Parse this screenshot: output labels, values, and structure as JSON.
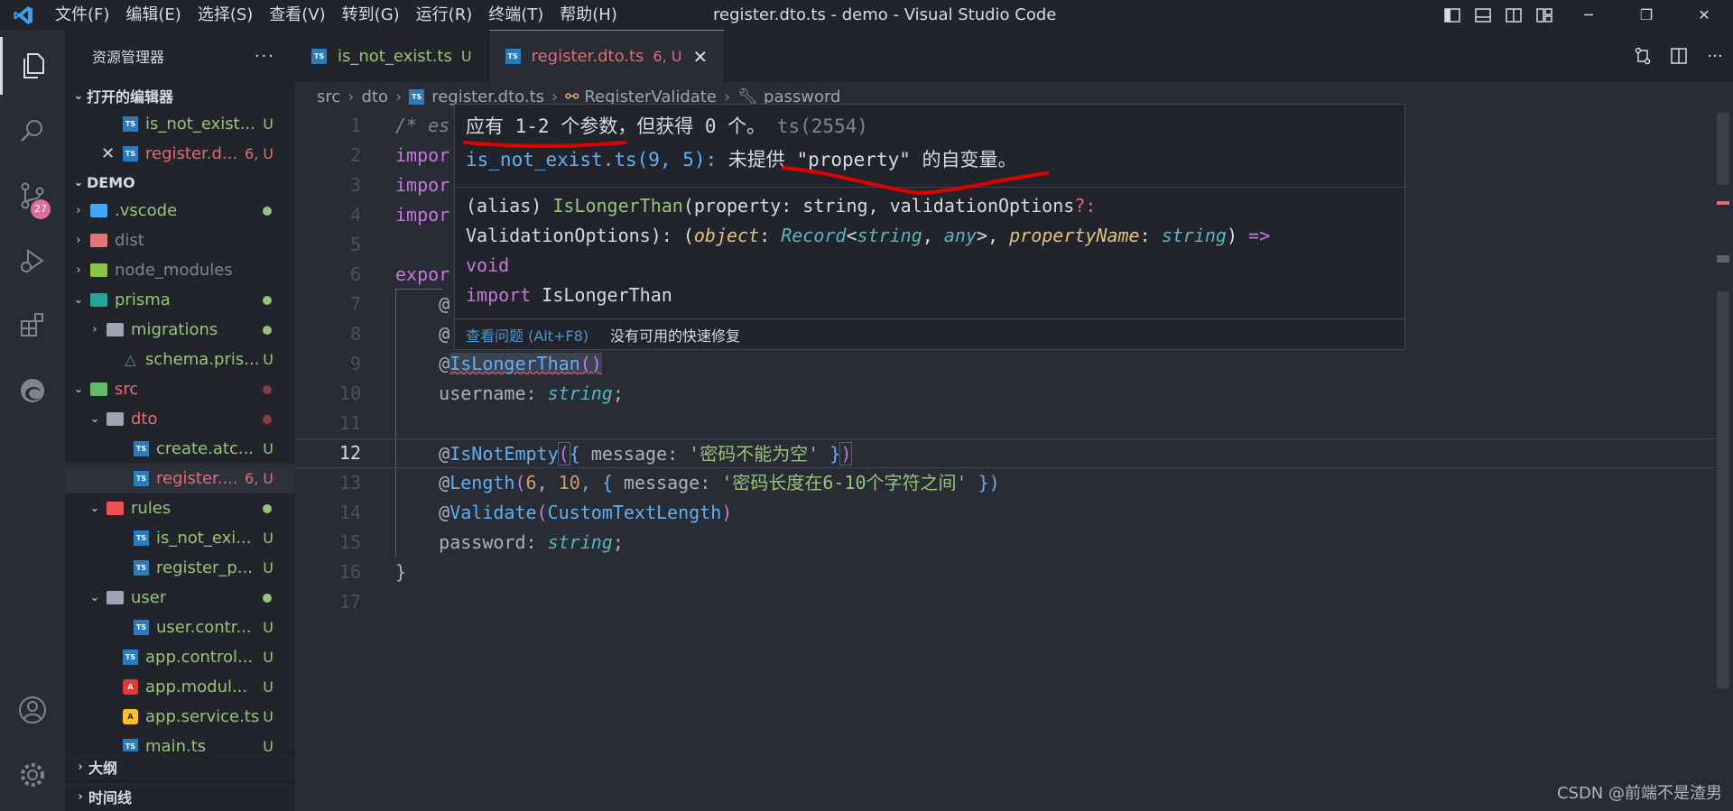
{
  "titlebar": {
    "menu": [
      "文件(F)",
      "编辑(E)",
      "选择(S)",
      "查看(V)",
      "转到(G)",
      "运行(R)",
      "终端(T)",
      "帮助(H)"
    ],
    "title": "register.dto.ts - demo - Visual Studio Code"
  },
  "activitybar": {
    "scm_badge": "27",
    "items": [
      "explorer-icon",
      "search-icon",
      "source-control-icon",
      "run-debug-icon",
      "extensions-icon",
      "edge-icon",
      "account-icon",
      "settings-gear-icon"
    ]
  },
  "sidebar": {
    "title": "资源管理器",
    "more": "···",
    "open_editors": {
      "label": "打开的编辑器",
      "items": [
        {
          "name": "is_not_exist...",
          "status": "U"
        },
        {
          "name": "register.d...",
          "status": "6, U"
        }
      ]
    },
    "workspace": {
      "label": "DEMO",
      "rows": [
        {
          "name": ".vscode",
          "kind": "folder"
        },
        {
          "name": "dist",
          "kind": "folder"
        },
        {
          "name": "node_modules",
          "kind": "folder"
        },
        {
          "name": "prisma",
          "kind": "folder"
        },
        {
          "name": "migrations",
          "kind": "folder"
        },
        {
          "name": "schema.pris...",
          "status": "U"
        },
        {
          "name": "src",
          "kind": "folder"
        },
        {
          "name": "dto",
          "kind": "folder"
        },
        {
          "name": "create.atc...",
          "status": "U"
        },
        {
          "name": "register....",
          "status": "6, U"
        },
        {
          "name": "rules",
          "kind": "folder"
        },
        {
          "name": "is_not_exi...",
          "status": "U"
        },
        {
          "name": "register_p...",
          "status": "U"
        },
        {
          "name": "user",
          "kind": "folder"
        },
        {
          "name": "user.contr...",
          "status": "U"
        },
        {
          "name": "app.control...",
          "status": "U"
        },
        {
          "name": "app.modul...",
          "status": "U"
        },
        {
          "name": "app.service.ts",
          "status": "U"
        },
        {
          "name": "main.ts",
          "status": "U"
        }
      ]
    },
    "outline_label": "大纲",
    "timeline_label": "时间线"
  },
  "tabs": [
    {
      "label": "is_not_exist.ts",
      "status": "U"
    },
    {
      "label": "register.dto.ts",
      "status": "6, U",
      "close": "✕"
    }
  ],
  "breadcrumb": [
    "src",
    "dto",
    "register.dto.ts",
    "RegisterValidate",
    "password"
  ],
  "editor": {
    "line_numbers": [
      "1",
      "2",
      "3",
      "4",
      "5",
      "6",
      "7",
      "8",
      "9",
      "10",
      "11",
      "12",
      "13",
      "14",
      "15",
      "16",
      "17"
    ],
    "code": {
      "l1a": "/* es",
      "l2": "impor",
      "l3": "impor",
      "l4": "impor",
      "l6": "expor",
      "l7": "@",
      "l8": "@",
      "l9a": "@",
      "l9b": "IsLongerThan",
      "l9c": "()",
      "l10a": "username",
      "l10b": ": ",
      "l10c": "string",
      "l10d": ";",
      "l12a": "@",
      "l12b": "IsNotEmpty",
      "l12c": "(",
      "l12d": "{ ",
      "l12e": "message",
      "l12f": ": ",
      "l12g": "'密码不能为空'",
      "l12h": " }",
      "l12i": ")",
      "l13a": "@",
      "l13b": "Length",
      "l13c": "(",
      "l13d": "6",
      "l13e": ", ",
      "l13f": "10",
      "l13g": ", { ",
      "l13h": "message",
      "l13i": ": ",
      "l13j": "'密码长度在6-10个字符之间'",
      "l13k": " })",
      "l14a": "@",
      "l14b": "Validate",
      "l14c": "(",
      "l14d": "CustomTextLength",
      "l14e": ")",
      "l15a": "password",
      "l15b": ": ",
      "l15c": "string",
      "l15d": ";",
      "l16": "}"
    }
  },
  "hover": {
    "error1": "应有 1-2 个参数，但获得 0 个。",
    "error1_code": " ts(2554)",
    "error2_loc": "is_not_exist.ts(9, 5):",
    "error2_msg": " 未提供 \"property\" 的自变量。",
    "sig": {
      "a1": "(alias) ",
      "a2": "IsLongerThan",
      "a3": "(property: string, validationOptions",
      "a4": "?:",
      "b1": "ValidationOptions): (",
      "b2": "object",
      "b3": ": ",
      "b4": "Record",
      "b5": "<",
      "b6": "string",
      "b7": ", ",
      "b8": "any",
      "b9": ">, ",
      "b10": "propertyName",
      "b11": ": ",
      "b12": "string",
      "b13": ") ",
      "b14": "=>",
      "c1": "void",
      "d1": "import",
      "d2": " IsLongerThan"
    },
    "view_problem": "查看问题 (Alt+F8)",
    "no_fix": "没有可用的快速修复"
  },
  "watermark": "CSDN @前端不是渣男",
  "colors": {
    "accent": "#528bff",
    "error": "#e06c75",
    "annotation": "#e00000"
  }
}
